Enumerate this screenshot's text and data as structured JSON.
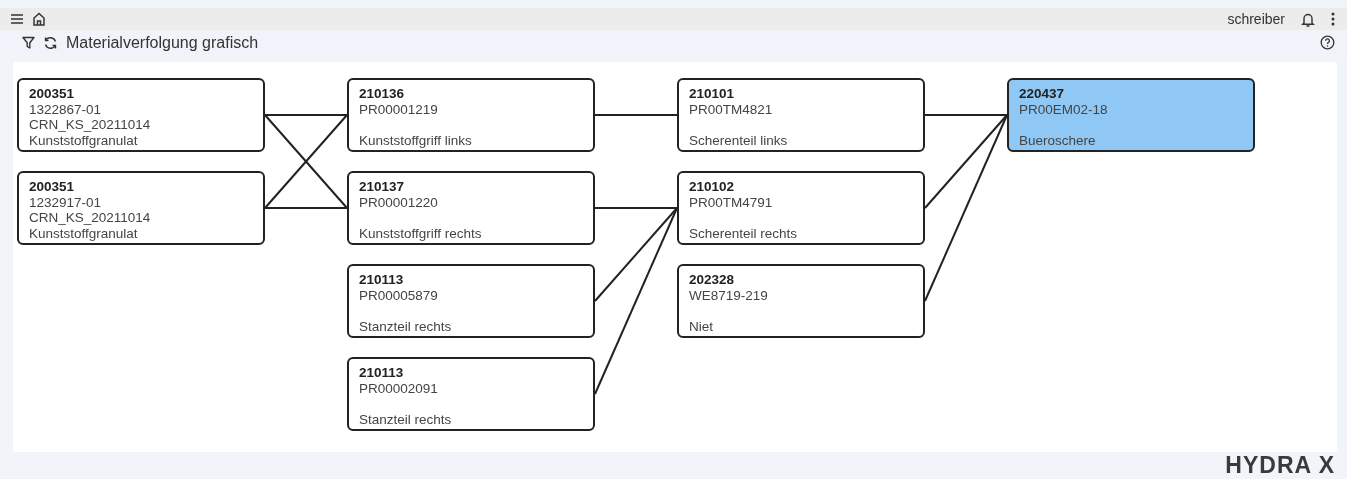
{
  "top_bar": {
    "user": "schreiber"
  },
  "title_bar": {
    "title": "Materialverfolgung grafisch"
  },
  "graph": {
    "columns": [
      [
        {
          "id": "200351",
          "code": "1322867-01",
          "batch": "CRN_KS_20211014",
          "description": "Kunststoffgranulat",
          "selected": false
        },
        {
          "id": "200351",
          "code": "1232917-01",
          "batch": "CRN_KS_20211014",
          "description": "Kunststoffgranulat",
          "selected": false
        }
      ],
      [
        {
          "id": "210136",
          "code": "PR00001219",
          "description": "Kunststoffgriff links",
          "selected": false
        },
        {
          "id": "210137",
          "code": "PR00001220",
          "description": "Kunststoffgriff rechts",
          "selected": false
        },
        {
          "id": "210113",
          "code": "PR00005879",
          "description": "Stanzteil rechts",
          "selected": false
        },
        {
          "id": "210113",
          "code": "PR00002091",
          "description": "Stanzteil rechts",
          "selected": false
        }
      ],
      [
        {
          "id": "210101",
          "code": "PR00TM4821",
          "description": "Scherenteil links",
          "selected": false
        },
        {
          "id": "210102",
          "code": "PR00TM4791",
          "description": "Scherenteil rechts",
          "selected": false
        },
        {
          "id": "202328",
          "code": "WE8719-219",
          "description": "Niet",
          "selected": false
        }
      ],
      [
        {
          "id": "220437",
          "code": "PR00EM02-18",
          "description": "Bueroschere",
          "selected": true
        }
      ]
    ]
  },
  "logo": "HYDRA X"
}
